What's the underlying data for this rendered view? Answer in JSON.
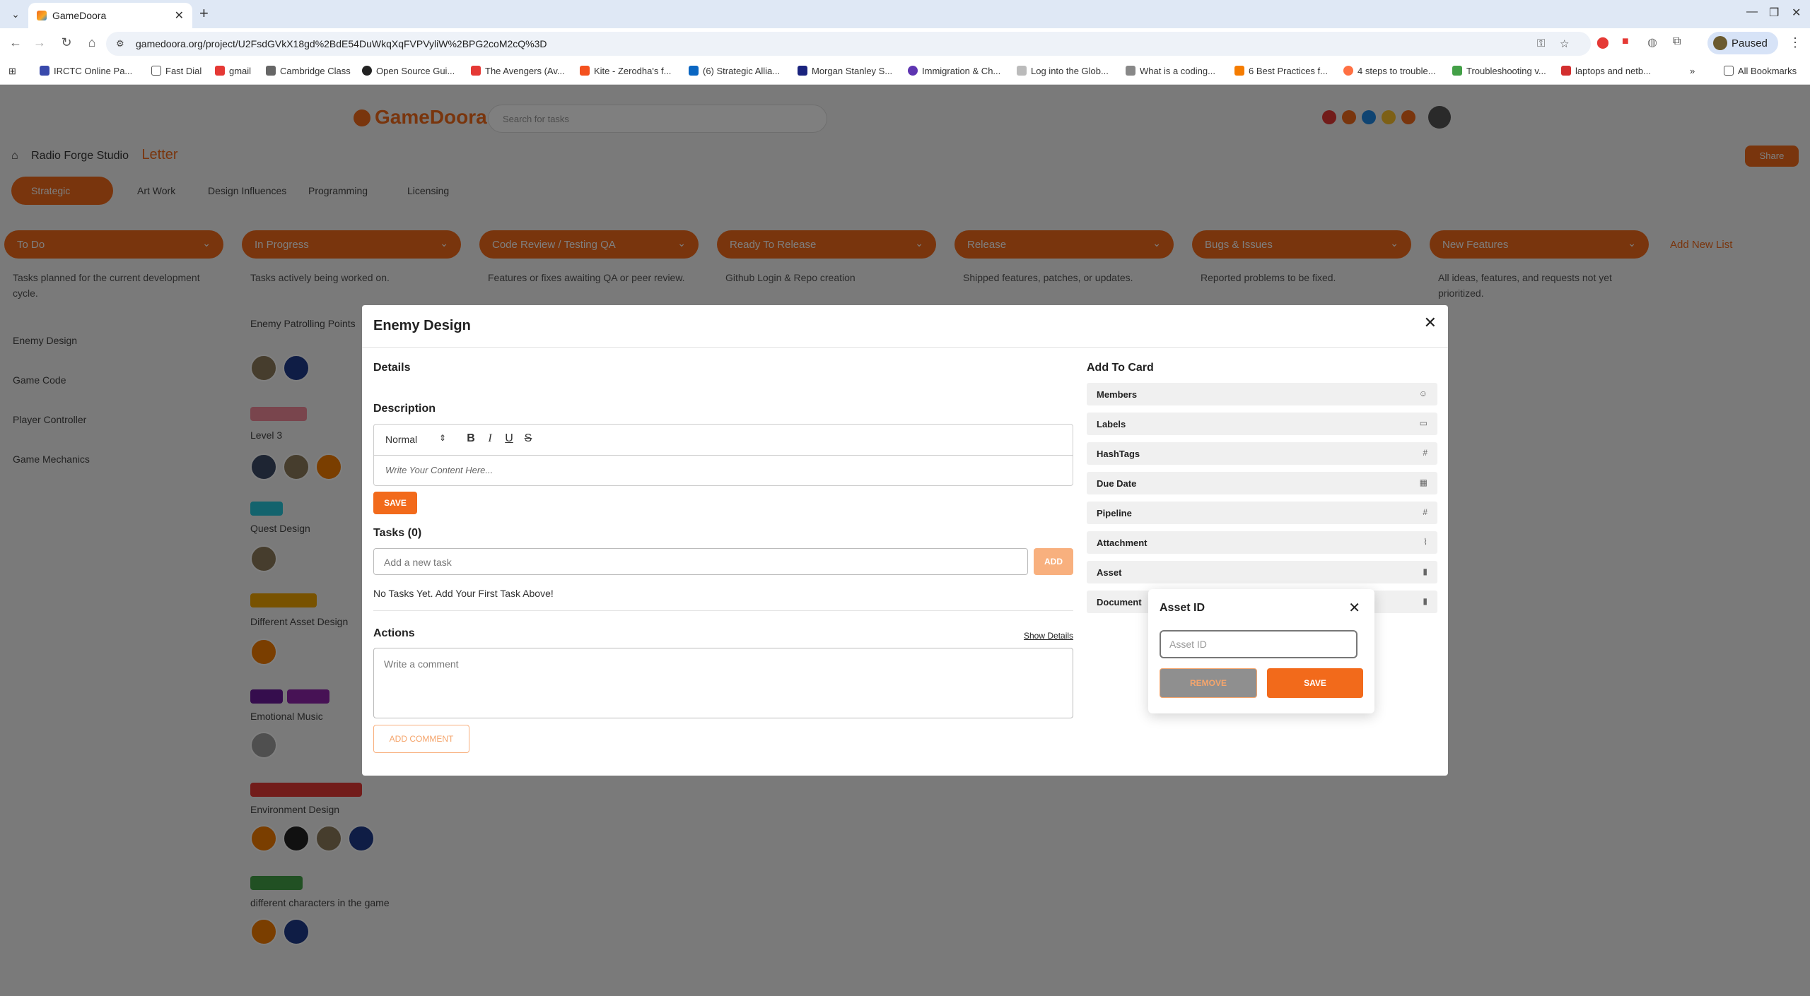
{
  "browser": {
    "tab_title": "GameDoora",
    "url": "gamedoora.org/project/U2FsdGVkX18gd%2BdE54DuWkqXqFVPVyliW%2BPG2coM2cQ%3D",
    "profile_status": "Paused",
    "bookmarks": [
      "IRCTC Online Pa...",
      "Fast Dial",
      "gmail",
      "Cambridge Class",
      "Open Source Gui...",
      "The Avengers (Av...",
      "Kite - Zerodha's f...",
      "(6) Strategic Allia...",
      "Morgan Stanley S...",
      "Immigration & Ch...",
      "Log into the Glob...",
      "What is a coding...",
      "6 Best Practices f...",
      "4 steps to trouble...",
      "Troubleshooting v...",
      "laptops and netb...",
      "All Bookmarks"
    ]
  },
  "background": {
    "logo": "GameDoora",
    "search_placeholder": "Search for tasks",
    "breadcrumb_studio": "Radio Forge Studio",
    "project_name": "Letter",
    "share_label": "Share",
    "project_tabs": [
      "Strategic",
      "Art Work",
      "Design Influences",
      "Programming",
      "Licensing"
    ],
    "columns": [
      {
        "title": "To Do",
        "desc": "Tasks planned for the current development cycle."
      },
      {
        "title": "In Progress",
        "desc": "Tasks actively being worked on."
      },
      {
        "title": "Code Review / Testing QA",
        "desc": "Features or fixes awaiting QA or peer review."
      },
      {
        "title": "Ready To Release",
        "desc": "Github Login & Repo creation"
      },
      {
        "title": "Release",
        "desc": "Shipped features, patches, or updates."
      },
      {
        "title": "Bugs & Issues",
        "desc": "Reported problems to be fixed."
      },
      {
        "title": "New Features",
        "desc": "All ideas, features, and requests not yet prioritized."
      }
    ],
    "add_list": "Add New List",
    "todo_cards": [
      "Enemy Design",
      "Game Code",
      "Player Controller",
      "Game Mechanics"
    ],
    "progress_cards": [
      "Enemy Patrolling Points",
      "Level 3",
      "Quest Design",
      "Different Asset Design",
      "Emotional Music",
      "Environment Design",
      "different characters in the game"
    ]
  },
  "modal": {
    "title": "Enemy Design",
    "details_heading": "Details",
    "description_heading": "Description",
    "format_select": "Normal",
    "tools": {
      "bold": "B",
      "italic": "I",
      "underline": "U",
      "strike": "S"
    },
    "editor_placeholder": "Write Your Content Here...",
    "save_label": "SAVE",
    "tasks_heading": "Tasks (0)",
    "task_placeholder": "Add a new task",
    "add_label": "ADD",
    "no_tasks": "No Tasks Yet. Add Your First Task Above!",
    "actions_heading": "Actions",
    "show_details": "Show Details",
    "comment_placeholder": "Write a comment",
    "add_comment": "ADD COMMENT",
    "add_to_card_heading": "Add To Card",
    "add_to_card": [
      {
        "label": "Members",
        "icon": "person-icon"
      },
      {
        "label": "Labels",
        "icon": "label-icon"
      },
      {
        "label": "HashTags",
        "icon": "hash-icon"
      },
      {
        "label": "Due Date",
        "icon": "calendar-icon"
      },
      {
        "label": "Pipeline",
        "icon": "hash-icon"
      },
      {
        "label": "Attachment",
        "icon": "paperclip-icon"
      },
      {
        "label": "Asset",
        "icon": "file-icon"
      },
      {
        "label": "Document",
        "icon": "file-icon"
      }
    ]
  },
  "asset_popover": {
    "title": "Asset ID",
    "input_placeholder": "Asset ID",
    "input_value": "",
    "remove_label": "REMOVE",
    "save_label": "SAVE"
  },
  "colors": {
    "accent": "#f26a1b",
    "accent_light": "#f8b07e"
  }
}
